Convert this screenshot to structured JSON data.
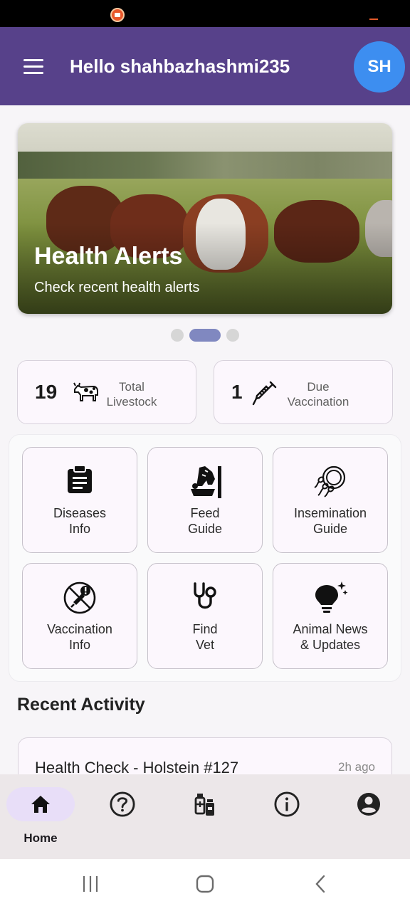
{
  "app_bar": {
    "greeting": "Hello shahbazhashmi235",
    "avatar_initials": "SH",
    "color": "#57418a"
  },
  "banner": {
    "title": "Health Alerts",
    "subtitle": "Check recent health alerts",
    "slides": 3,
    "active_slide": 2
  },
  "stats": [
    {
      "value": "19",
      "label_line1": "Total",
      "label_line2": "Livestock",
      "icon": "cow-icon"
    },
    {
      "value": "1",
      "label_line1": "Due",
      "label_line2": "Vaccination",
      "icon": "syringe-icon"
    }
  ],
  "features": [
    {
      "line1": "Diseases",
      "line2": "Info",
      "icon": "clipboard-icon"
    },
    {
      "line1": "Feed",
      "line2": "Guide",
      "icon": "feeding-icon"
    },
    {
      "line1": "Insemination",
      "line2": "Guide",
      "icon": "sperm-cell-icon"
    },
    {
      "line1": "Vaccination",
      "line2": "Info",
      "icon": "vaccine-alert-icon"
    },
    {
      "line1": "Find",
      "line2": "Vet",
      "icon": "stethoscope-icon"
    },
    {
      "line1": "Animal News",
      "line2": "& Updates",
      "icon": "lightbulb-icon"
    }
  ],
  "recent_activity": {
    "title": "Recent Activity",
    "items": [
      {
        "title": "Health Check - Holstein #127",
        "time": "2h ago"
      }
    ]
  },
  "bottom_nav": {
    "items": [
      {
        "label": "Home",
        "icon": "home-icon",
        "active": true
      },
      {
        "label": "",
        "icon": "help-icon",
        "active": false
      },
      {
        "label": "",
        "icon": "vaccine-vials-icon",
        "active": false
      },
      {
        "label": "",
        "icon": "info-icon",
        "active": false
      },
      {
        "label": "",
        "icon": "account-icon",
        "active": false
      }
    ]
  },
  "colors": {
    "accent": "#57418a",
    "avatar": "#3d8ef0",
    "active_pill": "#e8def8",
    "carousel_active": "#8088c0"
  }
}
